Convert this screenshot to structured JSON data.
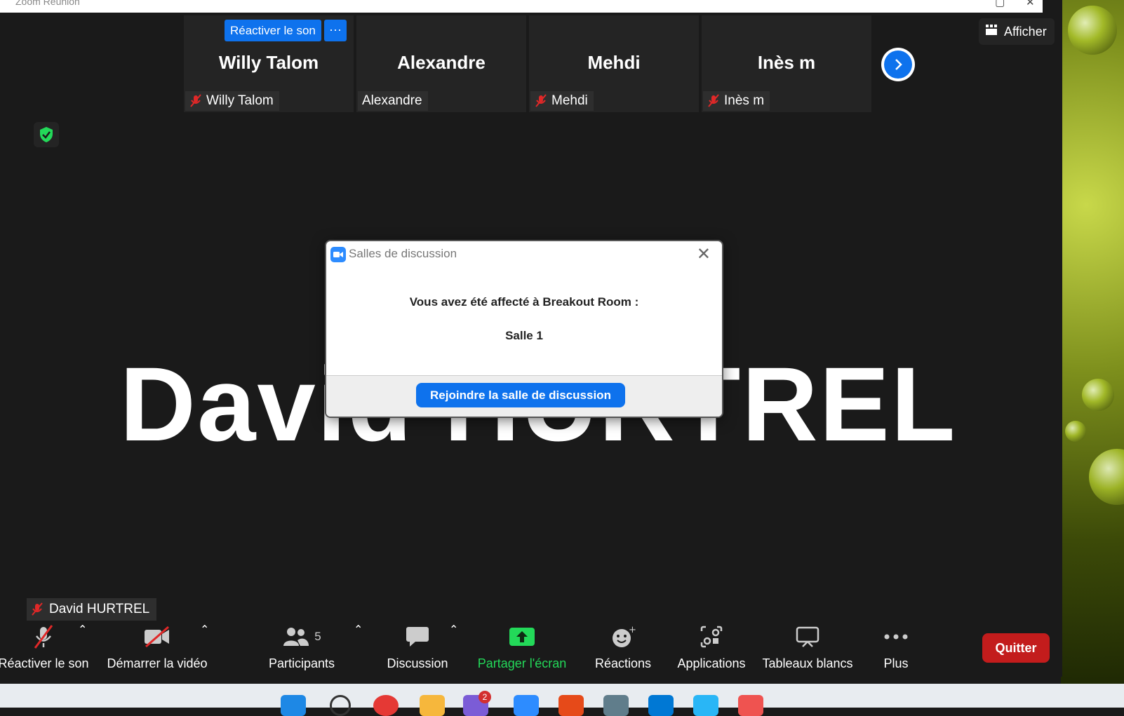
{
  "window": {
    "title": "Zoom Réunion"
  },
  "gallery": {
    "unmute_pill": "Réactiver le son",
    "unmute_more": "···",
    "tiles": [
      {
        "big_name": "Willy Talom",
        "tag": "Willy Talom",
        "muted": true
      },
      {
        "big_name": "Alexandre",
        "tag": "Alexandre",
        "muted": false
      },
      {
        "big_name": "Mehdi",
        "tag": "Mehdi",
        "muted": true
      },
      {
        "big_name": "Inès m",
        "tag": "Inès m",
        "muted": true
      }
    ],
    "view_label": "Afficher"
  },
  "speaker": {
    "name": "David HURTREL",
    "self_tag": "David HURTREL"
  },
  "dialog": {
    "title": "Salles de discussion",
    "message": "Vous avez été affecté à Breakout Room :",
    "room": "Salle 1",
    "join_label": "Rejoindre la salle de discussion"
  },
  "toolbar": {
    "unmute": "Réactiver le son",
    "video": "Démarrer la vidéo",
    "participants": "Participants",
    "participants_count": "5",
    "chat": "Discussion",
    "share": "Partager l'écran",
    "reactions": "Réactions",
    "apps": "Applications",
    "whiteboards": "Tableaux blancs",
    "more": "Plus",
    "leave": "Quitter"
  },
  "taskbar": {
    "badge": "2"
  },
  "colors": {
    "accent": "#0e72ed",
    "share_green": "#23d959",
    "leave_red": "#c31c1c",
    "secure_green": "#23d959"
  }
}
